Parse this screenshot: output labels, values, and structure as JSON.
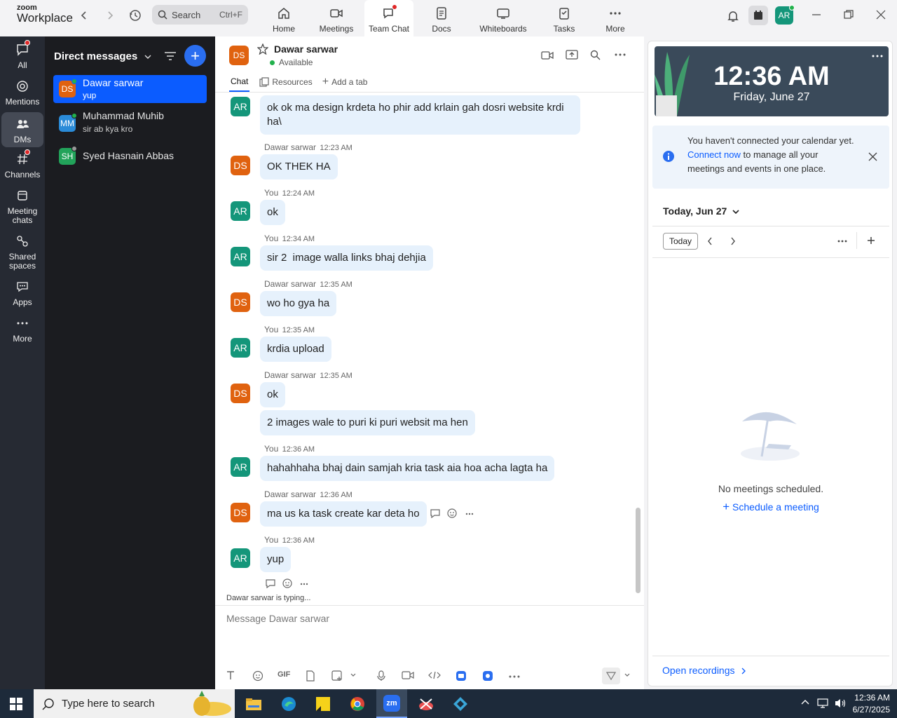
{
  "app": {
    "brand_small": "zoom",
    "brand_big": "Workplace"
  },
  "search": {
    "label": "Search",
    "shortcut": "Ctrl+F"
  },
  "nav_tabs": [
    {
      "label": "Home",
      "icon": "home-icon"
    },
    {
      "label": "Meetings",
      "icon": "video-icon"
    },
    {
      "label": "Team Chat",
      "icon": "chat-icon"
    },
    {
      "label": "Docs",
      "icon": "doc-icon"
    },
    {
      "label": "Whiteboards",
      "icon": "whiteboard-icon"
    },
    {
      "label": "Tasks",
      "icon": "tasks-icon"
    },
    {
      "label": "More",
      "icon": "more-icon"
    }
  ],
  "active_tab": "Team Chat",
  "user_avatar": "AR",
  "leftnav": [
    {
      "label": "All",
      "icon": "chat-bubble-icon"
    },
    {
      "label": "Mentions",
      "icon": "at-icon"
    },
    {
      "label": "DMs",
      "icon": "people-icon"
    },
    {
      "label": "Channels",
      "icon": "hash-icon"
    },
    {
      "label": "Meeting chats",
      "icon": "calendar-chat-icon"
    },
    {
      "label": "Shared spaces",
      "icon": "shared-icon"
    },
    {
      "label": "Apps",
      "icon": "apps-icon"
    },
    {
      "label": "More",
      "icon": "more-icon"
    }
  ],
  "dm_panel": {
    "title": "Direct messages",
    "contacts": [
      {
        "initials": "DS",
        "name": "Dawar sarwar",
        "preview": "yup",
        "color": "#e0620f",
        "active": true
      },
      {
        "initials": "MM",
        "name": "Muhammad Muhib",
        "preview": "sir ab kya kro",
        "color": "#2a8bd8",
        "active": false
      },
      {
        "initials": "SH",
        "name": "Syed Hasnain Abbas",
        "preview": "",
        "color": "#22a35a",
        "active": false
      }
    ]
  },
  "chat": {
    "header": {
      "initials": "DS",
      "name": "Dawar sarwar",
      "status": "Available"
    },
    "tabs": {
      "chat": "Chat",
      "resources": "Resources",
      "add": "Add a tab"
    },
    "messages": [
      {
        "who": "AR",
        "sender": "",
        "time": "",
        "text": "ok ok ma design krdeta ho phir add krlain gah dosri website krdi ha\\"
      },
      {
        "who": "DS",
        "sender": "Dawar sarwar",
        "time": "12:23 AM",
        "text": "OK THEK HA"
      },
      {
        "who": "AR",
        "sender": "You",
        "time": "12:24 AM",
        "text": "ok"
      },
      {
        "who": "AR",
        "sender": "You",
        "time": "12:34 AM",
        "text": "sir 2  image walla links bhaj dehjia"
      },
      {
        "who": "DS",
        "sender": "Dawar sarwar",
        "time": "12:35 AM",
        "text": "wo ho gya ha"
      },
      {
        "who": "AR",
        "sender": "You",
        "time": "12:35 AM",
        "text": "krdia upload"
      },
      {
        "who": "DS",
        "sender": "Dawar sarwar",
        "time": "12:35 AM",
        "text": "ok"
      },
      {
        "who": "DS",
        "sender": "",
        "time": "",
        "text": "2 images wale to puri ki puri websit ma hen"
      },
      {
        "who": "AR",
        "sender": "You",
        "time": "12:36 AM",
        "text": "hahahhaha bhaj dain samjah kria task aia hoa acha lagta ha"
      },
      {
        "who": "DS",
        "sender": "Dawar sarwar",
        "time": "12:36 AM",
        "text": "ma us ka task create kar deta ho"
      },
      {
        "who": "AR",
        "sender": "You",
        "time": "12:36 AM",
        "text": "yup"
      }
    ],
    "typing": "Dawar sarwar  is typing...",
    "composer_placeholder": "Message Dawar sarwar",
    "toolbar": {
      "gif": "GIF"
    }
  },
  "calendar": {
    "time": "12:36 AM",
    "date": "Friday, June 27",
    "notice_pre": "You haven't connected your calendar yet. ",
    "notice_link": "Connect now",
    "notice_post": " to manage all your meetings and events in one place.",
    "day_header": "Today, Jun 27",
    "today_button": "Today",
    "empty": "No meetings scheduled.",
    "schedule": "Schedule a meeting",
    "open_recordings": "Open recordings"
  },
  "taskbar": {
    "search": "Type here to search",
    "time": "12:36 AM",
    "date": "6/27/2025",
    "zoom_label": "zm"
  },
  "colors": {
    "accent": "#0b5cff",
    "bubble": "#e6f1fc",
    "sidebar": "#262a33",
    "dm_panel": "#1b1c20"
  }
}
